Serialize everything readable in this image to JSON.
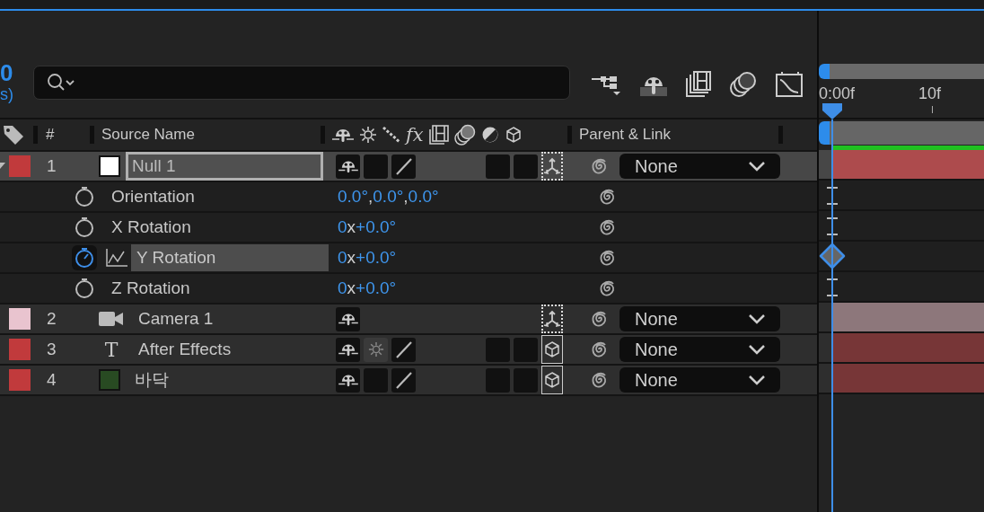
{
  "time_display": {
    "timecode": "0",
    "fps": "s)"
  },
  "columns": {
    "number": "#",
    "source_name": "Source Name",
    "effects": "fx",
    "parent": "Parent & Link"
  },
  "ruler": {
    "labels": [
      "0:00f",
      "10f"
    ]
  },
  "layers": [
    {
      "number": "1",
      "color": "#c13a3c",
      "kind": "null",
      "swatch": {
        "color": "#ffffff"
      },
      "name": "Null 1",
      "selected": true,
      "editing": true,
      "expanded": true,
      "switches": {
        "collapse": {
          "kind": "empty"
        },
        "quality": true,
        "motion_blur": true,
        "three_d": {
          "kind": "axes"
        }
      },
      "parent": "None",
      "bar": {
        "color": "#ad4b4d"
      },
      "properties": [
        {
          "name": "Orientation",
          "value": [
            "0.0°",
            ",",
            "0.0°",
            ",",
            "0.0°"
          ],
          "stopwatch_on": false,
          "selected": false,
          "keyframe": false
        },
        {
          "name": "X Rotation",
          "value": [
            "0",
            "x",
            "+0.0°"
          ],
          "stopwatch_on": false,
          "selected": false,
          "keyframe": false
        },
        {
          "name": "Y Rotation",
          "value": [
            "0",
            "x",
            "+0.0°"
          ],
          "stopwatch_on": true,
          "selected": true,
          "keyframe": true
        },
        {
          "name": "Z Rotation",
          "value": [
            "0",
            "x",
            "+0.0°"
          ],
          "stopwatch_on": false,
          "selected": false,
          "keyframe": false
        }
      ]
    },
    {
      "number": "2",
      "color": "#e9c4cf",
      "kind": "camera",
      "name": "Camera 1",
      "selected": false,
      "editing": false,
      "expanded": false,
      "switches": {
        "quality": false,
        "motion_blur": false,
        "three_d": {
          "kind": "axes"
        }
      },
      "parent": "None",
      "bar": {
        "color": "#8d777b"
      }
    },
    {
      "number": "3",
      "color": "#c13a3c",
      "kind": "text",
      "glyph": "T",
      "name": "After Effects",
      "selected": false,
      "editing": false,
      "expanded": false,
      "switches": {
        "collapse": {
          "kind": "sun"
        },
        "quality": true,
        "motion_blur": true,
        "three_d": {
          "kind": "cube"
        }
      },
      "parent": "None",
      "bar": {
        "color": "#773637"
      }
    },
    {
      "number": "4",
      "color": "#c13a3c",
      "kind": "solid",
      "swatch": {
        "color": "#284a22"
      },
      "name": "바닥",
      "selected": false,
      "editing": false,
      "expanded": false,
      "switches": {
        "collapse": {
          "kind": "empty"
        },
        "quality": true,
        "motion_blur": true,
        "three_d": {
          "kind": "cube"
        }
      },
      "parent": "None",
      "bar": {
        "color": "#773637"
      }
    }
  ]
}
